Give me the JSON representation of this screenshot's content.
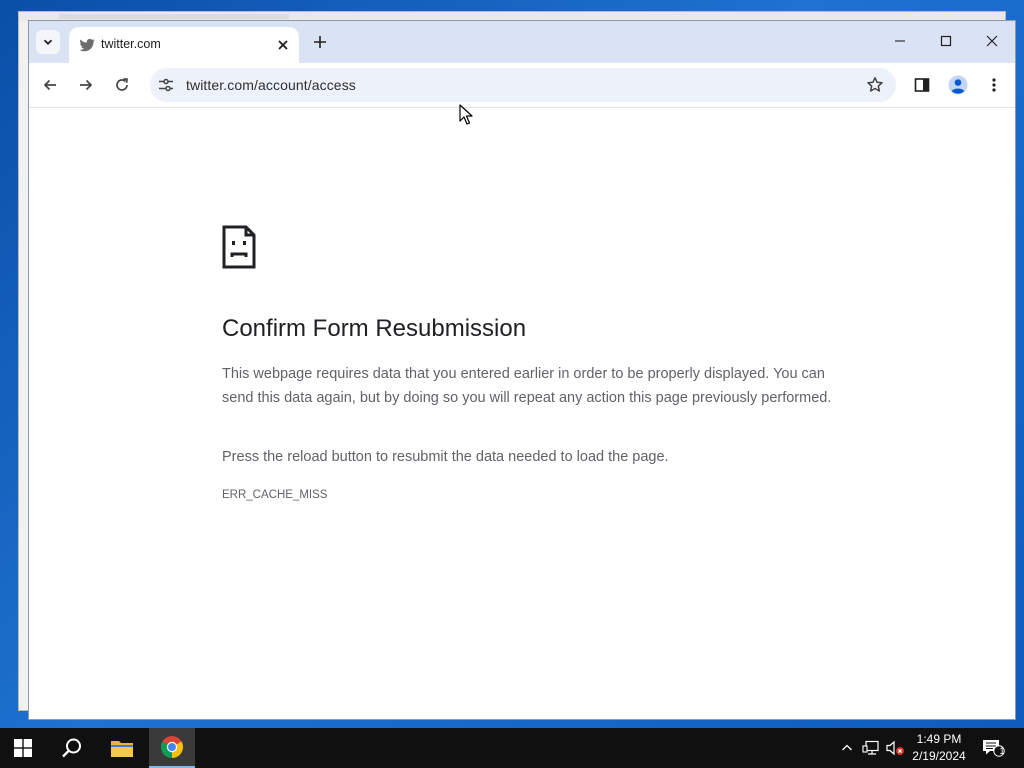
{
  "browser": {
    "tab": {
      "title": "twitter.com",
      "favicon": "twitter-bird-icon"
    },
    "address_bar": {
      "url": "twitter.com/account/access"
    },
    "icons": {
      "tab_search": "chevron-down-icon",
      "new_tab": "plus-icon",
      "back": "arrow-left-icon",
      "forward": "arrow-right-icon",
      "reload": "reload-icon",
      "site_info": "tune-icon",
      "bookmark": "star-icon",
      "side_panel": "side-panel-icon",
      "profile": "profile-icon",
      "menu": "kebab-menu-icon"
    }
  },
  "error_page": {
    "icon": "sad-document-icon",
    "title": "Confirm Form Resubmission",
    "paragraph1": "This webpage requires data that you entered earlier in order to be properly displayed. You can send this data again, but by doing so you will repeat any action this page previously performed.",
    "paragraph2": "Press the reload button to resubmit the data needed to load the page.",
    "error_code": "ERR_CACHE_MISS"
  },
  "taskbar": {
    "clock_time": "1:49 PM",
    "clock_date": "2/19/2024",
    "notification_count": "1"
  },
  "colors": {
    "tabbar": "#dae3f4",
    "omnibox": "#edf1f9",
    "accent_blue": "#1a73e8",
    "taskbar": "#101010"
  }
}
